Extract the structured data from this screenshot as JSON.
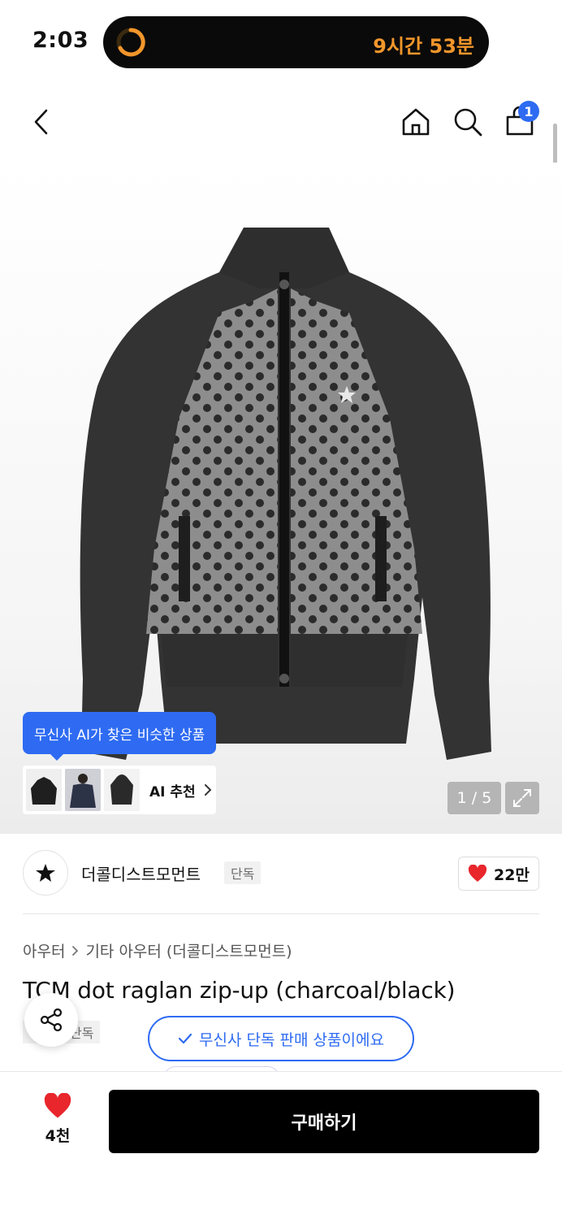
{
  "status": {
    "time": "2:03",
    "timer": "9시간 53분"
  },
  "nav": {
    "cart_count": "1"
  },
  "gallery": {
    "ai_tooltip": "무신사 AI가 찾은 비슷한 상품",
    "ai_reco_label": "AI 추천",
    "page_counter": "1 / 5"
  },
  "brand": {
    "name": "더콜디스트모먼트",
    "tag": "단독",
    "likes": "22만"
  },
  "product": {
    "category": "아우터",
    "subcategory": "기타 아우터 (더콜디스트모먼트)",
    "title": "TCM dot raglan zip-up (charcoal/black)",
    "tag": "단독"
  },
  "banner": {
    "exclusive": "무신사 단독 판매 상품이에요"
  },
  "bottom": {
    "wish_count": "4천",
    "buy_label": "구매하기"
  },
  "colors": {
    "accent": "#2e6bf2",
    "heart": "#e8262c",
    "timer": "#f2962b"
  }
}
